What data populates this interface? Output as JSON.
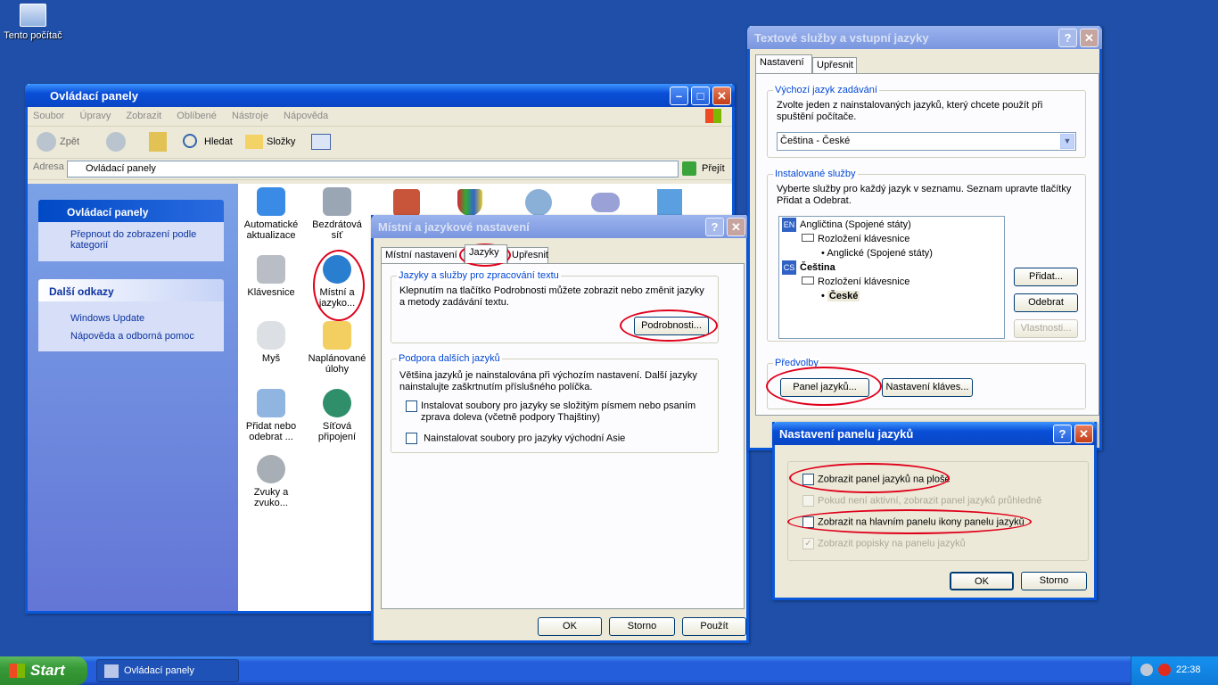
{
  "desktop": {
    "my_computer": "Tento počítač"
  },
  "control_panel": {
    "title": "Ovládací panely",
    "menu": [
      "Soubor",
      "Úpravy",
      "Zobrazit",
      "Oblíbené",
      "Nástroje",
      "Nápověda"
    ],
    "toolbar": {
      "back": "Zpět",
      "search": "Hledat",
      "folders": "Složky"
    },
    "address_label": "Adresa",
    "address_value": "Ovládací panely",
    "go": "Přejít",
    "side_panel_title": "Ovládací panely",
    "switch_view": "Přepnout do zobrazení podle kategorií",
    "other_links_title": "Další odkazy",
    "windows_update": "Windows Update",
    "help": "Nápověda a odborná pomoc",
    "icons": [
      {
        "label": "Automatické aktualizace"
      },
      {
        "label": "Bezdrátová síť"
      },
      {
        "label": "Klávesnice"
      },
      {
        "label": "Místní a jazyko..."
      },
      {
        "label": "Myš"
      },
      {
        "label": "Naplánované úlohy"
      },
      {
        "label": "Přidat nebo odebrat ..."
      },
      {
        "label": "Síťová připojení"
      },
      {
        "label": "Zvuky a zvuko..."
      }
    ]
  },
  "regional": {
    "title": "Místní a jazykové nastavení",
    "tabs": [
      "Místní nastavení",
      "Jazyky",
      "Upřesnit"
    ],
    "group1_title": "Jazyky a služby pro zpracování textu",
    "group1_text": "Klepnutím na tlačítko Podrobnosti můžete zobrazit nebo změnit jazyky a metody zadávání textu.",
    "details_button": "Podrobnosti...",
    "group2_title": "Podpora dalších jazyků",
    "group2_text": "Většina jazyků je nainstalována při výchozím nastavení. Další jazyky nainstalujte zaškrtnutím příslušného políčka.",
    "check_complex": "Instalovat soubory pro jazyky se složitým písmem nebo psaním zprava doleva (včetně podpory Thajštiny)",
    "check_east_asia": "Nainstalovat soubory pro jazyky východní Asie",
    "ok": "OK",
    "cancel": "Storno",
    "apply": "Použít"
  },
  "text_services": {
    "title": "Textové služby a vstupní jazyky",
    "tabs": [
      "Nastavení",
      "Upřesnit"
    ],
    "default_group": "Výchozí jazyk zadávání",
    "default_text": "Zvolte jeden z nainstalovaných jazyků, který chcete použít při spuštění počítače.",
    "default_value": "Čeština - České",
    "installed_group": "Instalované služby",
    "installed_text": "Vyberte služby pro každý jazyk v seznamu. Seznam upravte tlačítky Přidat a Odebrat.",
    "tree": {
      "en_code": "EN",
      "en_lang": "Angličtina (Spojené státy)",
      "en_kb": "Rozložení klávesnice",
      "en_layout": "Anglické (Spojené státy)",
      "cs_code": "CS",
      "cs_lang": "Čeština",
      "cs_kb": "Rozložení klávesnice",
      "cs_layout": "České"
    },
    "add": "Přidat...",
    "remove": "Odebrat",
    "properties": "Vlastnosti...",
    "prefs_group": "Předvolby",
    "lang_bar": "Panel jazyků...",
    "key_settings": "Nastavení kláves..."
  },
  "lang_bar": {
    "title": "Nastavení panelu jazyků",
    "opt1": "Zobrazit panel jazyků na ploše",
    "opt2": "Pokud není aktivní, zobrazit panel jazyků průhledně",
    "opt3": "Zobrazit na hlavním panelu ikony panelu jazyků",
    "opt4": "Zobrazit popisky na panelu jazyků",
    "ok": "OK",
    "cancel": "Storno"
  },
  "taskbar": {
    "start": "Start",
    "task": "Ovládací panely",
    "clock": "22:38"
  }
}
